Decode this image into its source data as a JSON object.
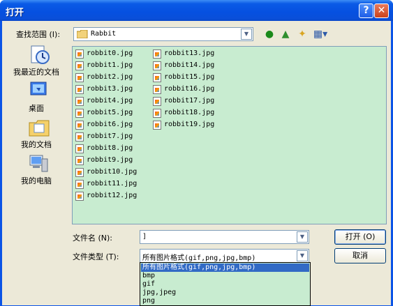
{
  "window": {
    "title": "打开",
    "help": "?",
    "close": "✕"
  },
  "lookin": {
    "label": "查找范围 (I):",
    "value": "Rabbit"
  },
  "places": [
    {
      "label": "我最近的文档"
    },
    {
      "label": "桌面"
    },
    {
      "label": "我的文档"
    },
    {
      "label": "我的电脑"
    }
  ],
  "files_col1": [
    "robbit0.jpg",
    "robbit1.jpg",
    "robbit2.jpg",
    "robbit3.jpg",
    "robbit4.jpg",
    "robbit5.jpg",
    "robbit6.jpg",
    "robbit7.jpg",
    "robbit8.jpg",
    "robbit9.jpg",
    "robbit10.jpg",
    "robbit11.jpg",
    "robbit12.jpg"
  ],
  "files_col2": [
    "robbit13.jpg",
    "robbit14.jpg",
    "robbit15.jpg",
    "robbit16.jpg",
    "robbit17.jpg",
    "robbit18.jpg",
    "robbit19.jpg"
  ],
  "filename": {
    "label": "文件名 (N):",
    "value": "]"
  },
  "filetype": {
    "label": "文件类型 (T):",
    "value": "所有图片格式(gif,png,jpg,bmp)",
    "options": [
      "所有图片格式(gif,png,jpg,bmp)",
      "bmp",
      "gif",
      "jpg,jpeg",
      "png"
    ]
  },
  "buttons": {
    "open": "打开 (O)",
    "cancel": "取消"
  }
}
